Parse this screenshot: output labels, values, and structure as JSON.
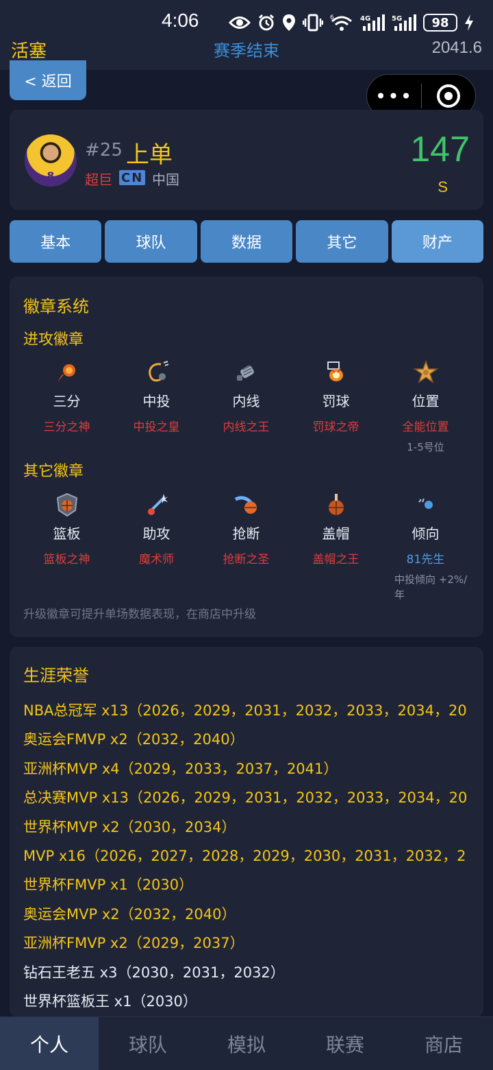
{
  "status": {
    "time": "4:06",
    "battery": "98",
    "signal1": "4G",
    "signal2": "5G",
    "wifi_badge": "6"
  },
  "header": {
    "team": "活塞",
    "title": "赛季结束",
    "season": "2041.6"
  },
  "back_label": "< 返回",
  "capsule": {
    "more": "•••"
  },
  "player": {
    "avatar_number": "8",
    "number": "#25",
    "name": "上单",
    "tier": "超巨",
    "flag": "CN",
    "country": "中国",
    "overall": "147",
    "grade": "S"
  },
  "tabs": [
    "基本",
    "球队",
    "数据",
    "其它",
    "财产"
  ],
  "badges": {
    "title": "徽章系统",
    "offense_title": "进攻徽章",
    "offense": [
      {
        "icon": "fireball-icon",
        "name": "三分",
        "level": "三分之神"
      },
      {
        "icon": "hook-shot-icon",
        "name": "中投",
        "level": "中投之皇"
      },
      {
        "icon": "fist-icon",
        "name": "内线",
        "level": "内线之王"
      },
      {
        "icon": "hoop-icon",
        "name": "罚球",
        "level": "罚球之帝"
      },
      {
        "icon": "star-icon",
        "name": "位置",
        "level": "全能位置",
        "note": "1-5号位"
      }
    ],
    "other_title": "其它徽章",
    "other": [
      {
        "icon": "shield-icon",
        "name": "篮板",
        "level": "篮板之神"
      },
      {
        "icon": "magic-wand-icon",
        "name": "助攻",
        "level": "魔术师"
      },
      {
        "icon": "steal-icon",
        "name": "抢断",
        "level": "抢断之圣"
      },
      {
        "icon": "block-hand-icon",
        "name": "盖帽",
        "level": "盖帽之王"
      },
      {
        "icon": "tendency-icon",
        "name": "倾向",
        "level": "81先生",
        "note": "中投倾向 +2%/年"
      }
    ],
    "hint": "升级徽章可提升单场数据表现，在商店中升级"
  },
  "honors": {
    "title": "生涯荣誉",
    "items": [
      {
        "text": "NBA总冠军 x13（2026，2029，2031，2032，2033，2034，20",
        "color": "gold"
      },
      {
        "text": "奥运会FMVP x2（2032，2040）",
        "color": "gold"
      },
      {
        "text": "亚洲杯MVP x4（2029，2033，2037，2041）",
        "color": "gold"
      },
      {
        "text": "总决赛MVP x13（2026，2029，2031，2032，2033，2034，20",
        "color": "gold"
      },
      {
        "text": "世界杯MVP x2（2030，2034）",
        "color": "gold"
      },
      {
        "text": "MVP x16（2026，2027，2028，2029，2030，2031，2032，2",
        "color": "gold"
      },
      {
        "text": "世界杯FMVP x1（2030）",
        "color": "gold"
      },
      {
        "text": "奥运会MVP x2（2032，2040）",
        "color": "gold"
      },
      {
        "text": "亚洲杯FMVP x2（2029，2037）",
        "color": "gold"
      },
      {
        "text": "钻石王老五 x3（2030，2031，2032）",
        "color": "white"
      },
      {
        "text": "世界杯篮板王 x1（2030）",
        "color": "white"
      }
    ]
  },
  "nav": [
    "个人",
    "球队",
    "模拟",
    "联赛",
    "商店"
  ]
}
